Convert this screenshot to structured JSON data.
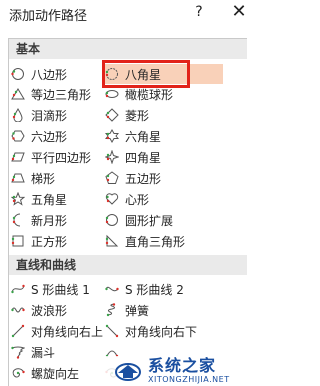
{
  "dialog": {
    "title": "添加动作路径",
    "help": "?",
    "close": "✕"
  },
  "sections": {
    "basic": "基本",
    "lines": "直线和曲线"
  },
  "basic_items": [
    {
      "label": "八边形",
      "icon": "octagon-icon"
    },
    {
      "label": "八角星",
      "icon": "eight-point-star-icon",
      "selected": true
    },
    {
      "label": "等边三角形",
      "icon": "equilateral-triangle-icon"
    },
    {
      "label": "橄榄球形",
      "icon": "football-icon"
    },
    {
      "label": "泪滴形",
      "icon": "teardrop-icon"
    },
    {
      "label": "菱形",
      "icon": "diamond-icon"
    },
    {
      "label": "六边形",
      "icon": "hexagon-icon"
    },
    {
      "label": "六角星",
      "icon": "six-point-star-icon"
    },
    {
      "label": "平行四边形",
      "icon": "parallelogram-icon"
    },
    {
      "label": "四角星",
      "icon": "four-point-star-icon"
    },
    {
      "label": "梯形",
      "icon": "trapezoid-icon"
    },
    {
      "label": "五边形",
      "icon": "pentagon-icon"
    },
    {
      "label": "五角星",
      "icon": "five-point-star-icon"
    },
    {
      "label": "心形",
      "icon": "heart-icon"
    },
    {
      "label": "新月形",
      "icon": "crescent-icon"
    },
    {
      "label": "圆形扩展",
      "icon": "circle-icon"
    },
    {
      "label": "正方形",
      "icon": "square-icon"
    },
    {
      "label": "直角三角形",
      "icon": "right-triangle-icon"
    }
  ],
  "line_items": [
    {
      "label": "S 形曲线 1",
      "icon": "s-curve-1-icon"
    },
    {
      "label": "S 形曲线 2",
      "icon": "s-curve-2-icon"
    },
    {
      "label": "波浪形",
      "icon": "wave-icon"
    },
    {
      "label": "弹簧",
      "icon": "spring-icon"
    },
    {
      "label": "对角线向右上",
      "icon": "diagonal-up-right-icon"
    },
    {
      "label": "对角线向右下",
      "icon": "diagonal-down-right-icon"
    },
    {
      "label": "漏斗",
      "icon": "funnel-icon"
    },
    {
      "label": "",
      "icon": "curve-icon"
    },
    {
      "label": "螺旋向左",
      "icon": "spiral-left-icon"
    },
    {
      "label": "",
      "icon": "spiral-right-icon"
    }
  ],
  "watermark": {
    "main": "系统之家",
    "sub": "XITONGZHIJIA.NET"
  },
  "colors": {
    "path_green": "#3aa14a",
    "path_red": "#d9302a",
    "selection_border": "#e2231a",
    "highlight": "#f9d1b9",
    "section_bg": "#eaeaea",
    "watermark_blue": "#1a4fa0"
  }
}
